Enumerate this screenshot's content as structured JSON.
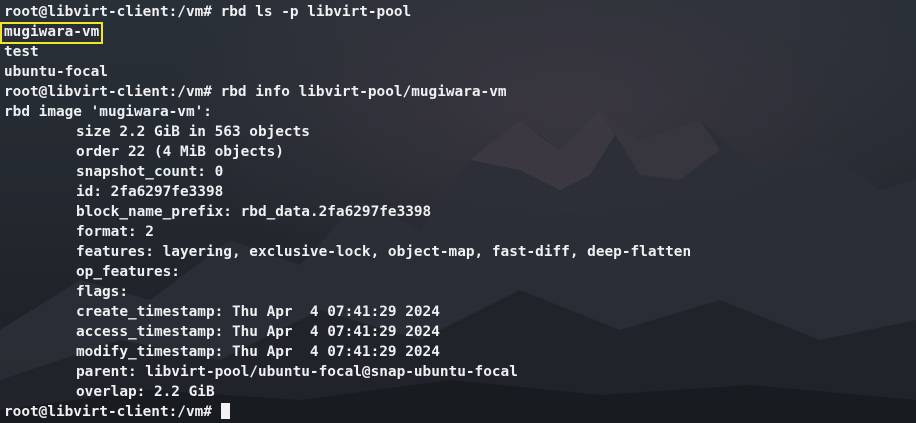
{
  "terminal": {
    "prompt": "root@libvirt-client:/vm# ",
    "cmd_ls": "rbd ls -p libvirt-pool",
    "ls_output": [
      "mugiwara-vm",
      "test",
      "ubuntu-focal"
    ],
    "cmd_info": "rbd info libvirt-pool/mugiwara-vm",
    "info_header": "rbd image 'mugiwara-vm':",
    "info_lines": [
      "size 2.2 GiB in 563 objects",
      "order 22 (4 MiB objects)",
      "snapshot_count: 0",
      "id: 2fa6297fe3398",
      "block_name_prefix: rbd_data.2fa6297fe3398",
      "format: 2",
      "features: layering, exclusive-lock, object-map, fast-diff, deep-flatten",
      "op_features:",
      "flags:",
      "create_timestamp: Thu Apr  4 07:41:29 2024",
      "access_timestamp: Thu Apr  4 07:41:29 2024",
      "modify_timestamp: Thu Apr  4 07:41:29 2024",
      "parent: libvirt-pool/ubuntu-focal@snap-ubuntu-focal",
      "overlap: 2.2 GiB"
    ],
    "highlight_color": "#f3e629"
  }
}
